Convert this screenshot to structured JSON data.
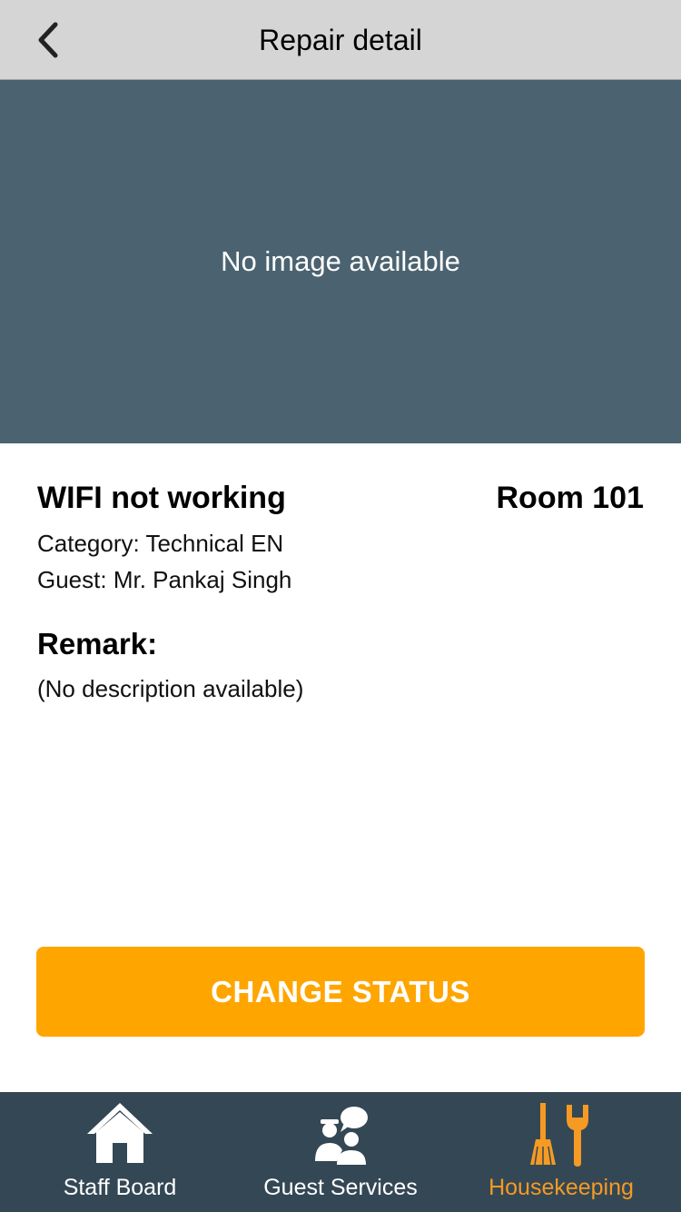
{
  "nav": {
    "title": "Repair detail",
    "back_icon": "chevron-left-icon"
  },
  "image": {
    "placeholder": "No image available",
    "background": "#4b6370"
  },
  "repair": {
    "title": "WIFI not working",
    "room": "Room 101",
    "category": "Category: Technical EN",
    "guest": "Guest: Mr. Pankaj Singh",
    "remark_label": "Remark:",
    "remark_text": "(No description available)"
  },
  "actions": {
    "change_status_label": "CHANGE STATUS",
    "accent": "#ffa500"
  },
  "tabbar": {
    "background": "#344755",
    "active_color": "#f59a23",
    "items": [
      {
        "label": "Staff Board",
        "icon": "house-icon",
        "active": false
      },
      {
        "label": "Guest Services",
        "icon": "guest-services-icon",
        "active": false
      },
      {
        "label": "Housekeeping",
        "icon": "broom-wrench-icon",
        "active": true
      }
    ]
  }
}
